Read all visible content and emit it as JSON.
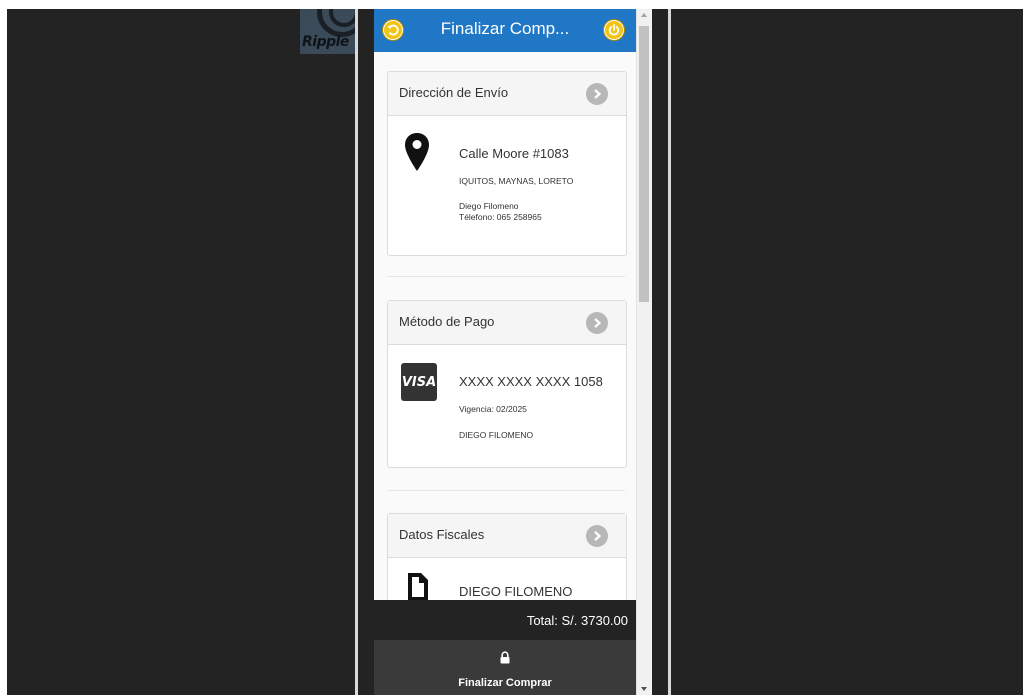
{
  "logo": {
    "text": "Ripple"
  },
  "header": {
    "title": "Finalizar Comp...",
    "back_icon": "back-icon",
    "power_icon": "power-icon",
    "accent": "#1f77c6",
    "button_color": "#f0c419"
  },
  "shipping": {
    "heading": "Dirección de Envío",
    "icon": "map-pin-icon",
    "address": "Calle Moore #1083",
    "region": "IQUITOS, MAYNAS, LORETO",
    "name": "Diego Filomeno",
    "phone": "Télefono: 065 258965"
  },
  "payment": {
    "heading": "Método de Pago",
    "icon": "visa-icon",
    "brand": "VISA",
    "card_number": "XXXX XXXX XXXX 1058",
    "expiry": "Vigencia: 02/2025",
    "holder": "DIEGO FILOMENO"
  },
  "fiscal": {
    "heading": "Datos Fiscales",
    "icon": "document-icon",
    "name": "DIEGO FILOMENO"
  },
  "footer": {
    "total": "Total: S/. 3730.00",
    "checkout_label": "Finalizar Comprar"
  }
}
